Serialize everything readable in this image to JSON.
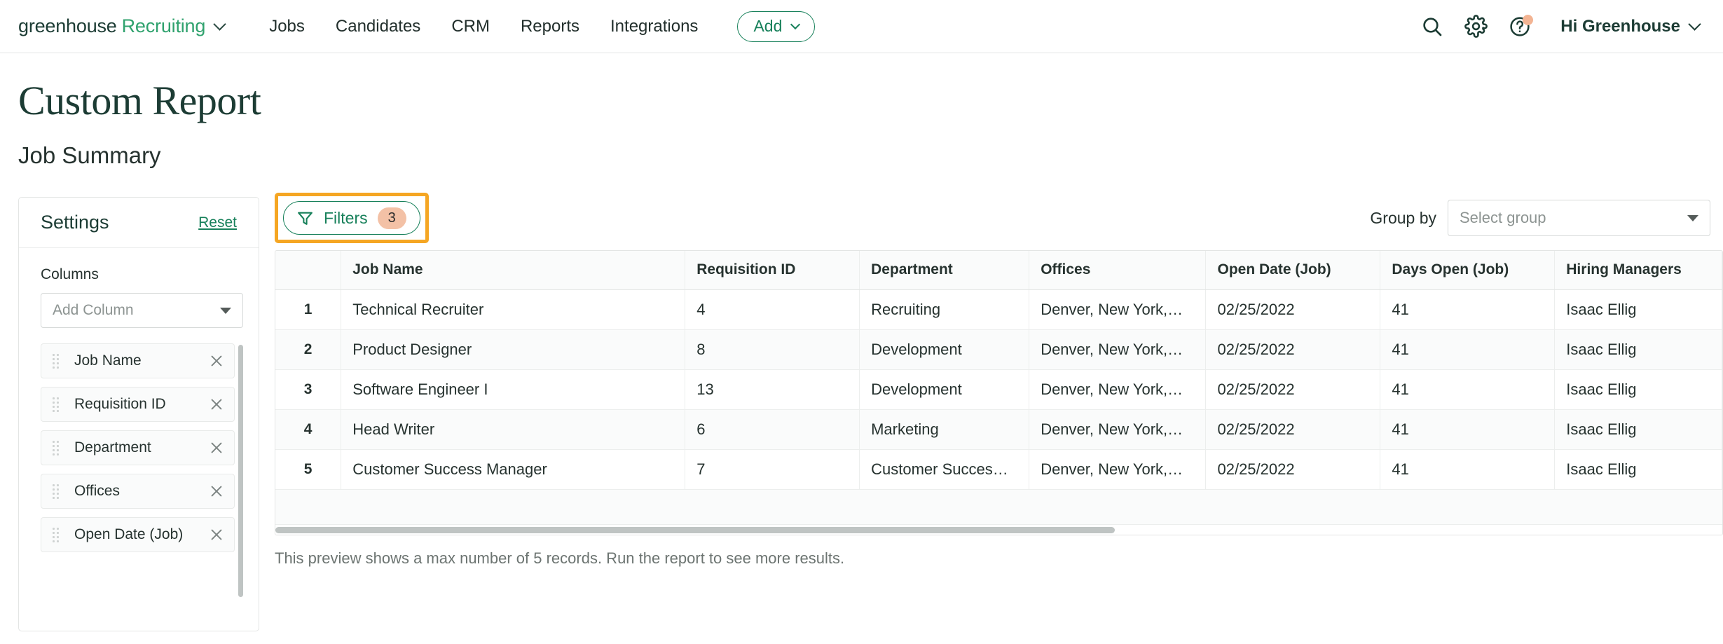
{
  "nav": {
    "logo_primary": "greenhouse",
    "logo_secondary": "Recruiting",
    "links": [
      "Jobs",
      "Candidates",
      "CRM",
      "Reports",
      "Integrations"
    ],
    "add_label": "Add",
    "greeting": "Hi Greenhouse",
    "icons": [
      "search-icon",
      "gear-icon",
      "help-icon"
    ]
  },
  "page": {
    "title": "Custom Report",
    "subtitle": "Job Summary"
  },
  "settings": {
    "title": "Settings",
    "reset_label": "Reset",
    "columns_label": "Columns",
    "add_column_placeholder": "Add Column",
    "items": [
      {
        "label": "Job Name"
      },
      {
        "label": "Requisition ID"
      },
      {
        "label": "Department"
      },
      {
        "label": "Offices"
      },
      {
        "label": "Open Date (Job)"
      }
    ]
  },
  "toolbar": {
    "filters_label": "Filters",
    "filters_count": "3",
    "group_by_label": "Group by",
    "group_by_placeholder": "Select group"
  },
  "table": {
    "columns": [
      "",
      "Job Name",
      "Requisition ID",
      "Department",
      "Offices",
      "Open Date (Job)",
      "Days Open (Job)",
      "Hiring Managers"
    ],
    "rows": [
      {
        "index": "1",
        "job_name": "Technical Recruiter",
        "requisition_id": "4",
        "department": "Recruiting",
        "offices": "Denver, New York,…",
        "open_date": "02/25/2022",
        "days_open": "41",
        "hiring_managers": "Isaac Ellig"
      },
      {
        "index": "2",
        "job_name": "Product Designer",
        "requisition_id": "8",
        "department": "Development",
        "offices": "Denver, New York,…",
        "open_date": "02/25/2022",
        "days_open": "41",
        "hiring_managers": "Isaac Ellig"
      },
      {
        "index": "3",
        "job_name": "Software Engineer I",
        "requisition_id": "13",
        "department": "Development",
        "offices": "Denver, New York,…",
        "open_date": "02/25/2022",
        "days_open": "41",
        "hiring_managers": "Isaac Ellig"
      },
      {
        "index": "4",
        "job_name": "Head Writer",
        "requisition_id": "6",
        "department": "Marketing",
        "offices": "Denver, New York,…",
        "open_date": "02/25/2022",
        "days_open": "41",
        "hiring_managers": "Isaac Ellig"
      },
      {
        "index": "5",
        "job_name": "Customer Success Manager",
        "requisition_id": "7",
        "department": "Customer Succes…",
        "offices": "Denver, New York,…",
        "open_date": "02/25/2022",
        "days_open": "41",
        "hiring_managers": "Isaac Ellig"
      }
    ],
    "preview_note": "This preview shows a max number of 5 records. Run the report to see more results."
  },
  "colors": {
    "brand_dark": "#1c3c34",
    "brand_green": "#17805a",
    "logo_green": "#30a26e",
    "highlight_orange": "#f5a623",
    "badge_peach": "#f3c1a6",
    "notification_dot": "#f3b493"
  }
}
